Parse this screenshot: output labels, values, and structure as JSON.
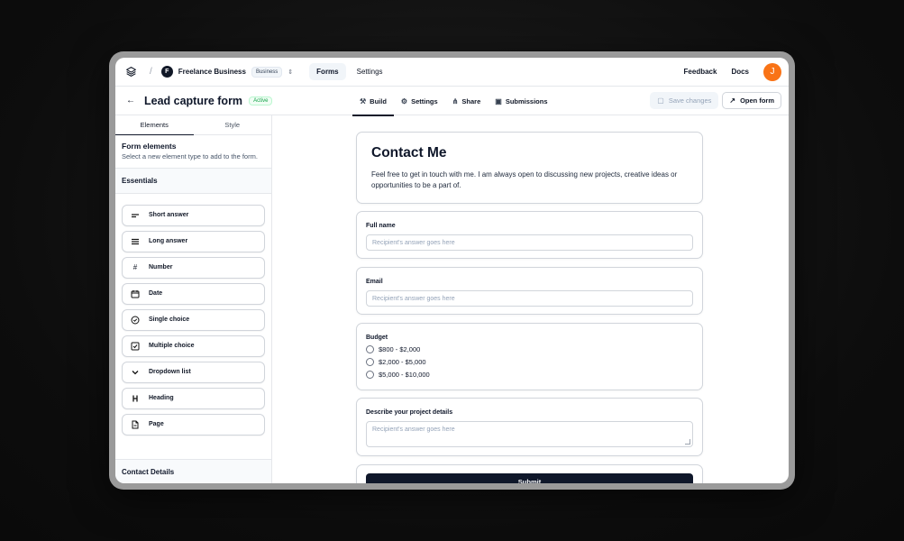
{
  "topbar": {
    "workspace_initial": "F",
    "workspace_name": "Freelance Business",
    "workspace_badge": "Business",
    "nav": [
      "Forms",
      "Settings"
    ],
    "feedback": "Feedback",
    "docs": "Docs",
    "user_initial": "J",
    "avatar_color": "#f97316"
  },
  "subbar": {
    "title": "Lead capture form",
    "status": "Active",
    "tabs": [
      {
        "label": "Build",
        "icon": "hammer-icon"
      },
      {
        "label": "Settings",
        "icon": "gear-icon"
      },
      {
        "label": "Share",
        "icon": "share-icon"
      },
      {
        "label": "Submissions",
        "icon": "inbox-icon"
      }
    ],
    "save_label": "Save changes",
    "open_label": "Open form"
  },
  "sidebar": {
    "tabs": [
      "Elements",
      "Style"
    ],
    "heading": "Form elements",
    "description": "Select a new element type to add to the form.",
    "section": "Essentials",
    "elements": [
      {
        "label": "Short answer",
        "icon": "short-text-icon"
      },
      {
        "label": "Long answer",
        "icon": "long-text-icon"
      },
      {
        "label": "Number",
        "icon": "hash-icon"
      },
      {
        "label": "Date",
        "icon": "calendar-icon"
      },
      {
        "label": "Single choice",
        "icon": "radio-icon"
      },
      {
        "label": "Multiple choice",
        "icon": "checkbox-icon"
      },
      {
        "label": "Dropdown list",
        "icon": "chevron-down-icon"
      },
      {
        "label": "Heading",
        "icon": "heading-icon"
      },
      {
        "label": "Page",
        "icon": "page-icon"
      }
    ],
    "bottom_section": "Contact Details"
  },
  "form": {
    "title": "Contact Me",
    "description": "Feel free to get in touch with me. I am always open to discussing new projects, creative ideas or opportunities to be a part of.",
    "fields": {
      "full_name": {
        "label": "Full name",
        "placeholder": "Recipient's answer goes here"
      },
      "email": {
        "label": "Email",
        "placeholder": "Recipient's answer goes here"
      },
      "budget": {
        "label": "Budget",
        "options": [
          "$800 - $2,000",
          "$2,000 - $5,000",
          "$5,000 - $10,000"
        ]
      },
      "details": {
        "label": "Describe your project details",
        "placeholder": "Recipient's answer goes here"
      }
    },
    "submit": "Submit"
  }
}
